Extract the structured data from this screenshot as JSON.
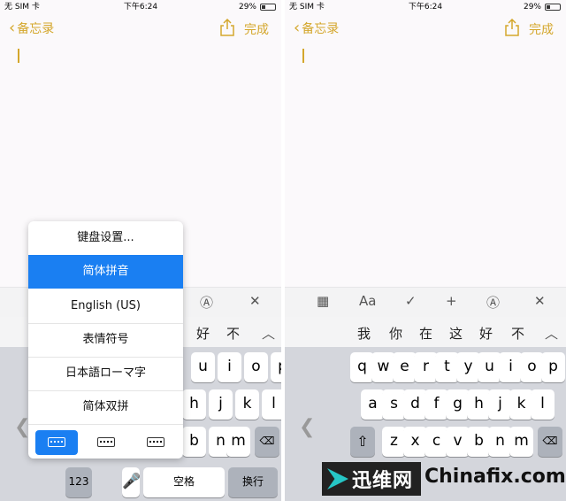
{
  "status": {
    "carrier": "无 SIM 卡",
    "time": "下午6:24",
    "battery": "29%",
    "battery_level": 0.29
  },
  "nav": {
    "back_label": "备忘录",
    "done_label": "完成"
  },
  "left": {
    "toolbar_visible": [
      "Ⓐ",
      "✕"
    ],
    "candidates": [
      "好",
      "不"
    ],
    "menu": [
      "键盘设置...",
      "简体拼音",
      "English (US)",
      "表情符号",
      "日本語ローマ字",
      "简体双拼"
    ],
    "rows": [
      [
        "u",
        "i",
        "o",
        "p"
      ],
      [
        "h",
        "j",
        "k",
        "l"
      ],
      [
        "b",
        "n",
        "m"
      ]
    ],
    "bottom": {
      "num": "123",
      "space": "空格",
      "return": "换行"
    }
  },
  "right": {
    "toolbar": [
      "▦",
      "Aa",
      "✓",
      "+",
      "Ⓐ",
      "✕"
    ],
    "candidates": [
      "我",
      "你",
      "在",
      "这",
      "好",
      "不"
    ],
    "rows": [
      [
        "q",
        "w",
        "e",
        "r",
        "t",
        "y",
        "u",
        "i",
        "o",
        "p"
      ],
      [
        "a",
        "s",
        "d",
        "f",
        "g",
        "h",
        "j",
        "k",
        "l"
      ],
      [
        "z",
        "x",
        "c",
        "v",
        "b",
        "n",
        "m"
      ]
    ]
  },
  "watermark": {
    "cn": "迅维网",
    "en": "Chinafix.com"
  },
  "colors": {
    "accent": "#d4a72c",
    "selected": "#1a7ff2"
  }
}
